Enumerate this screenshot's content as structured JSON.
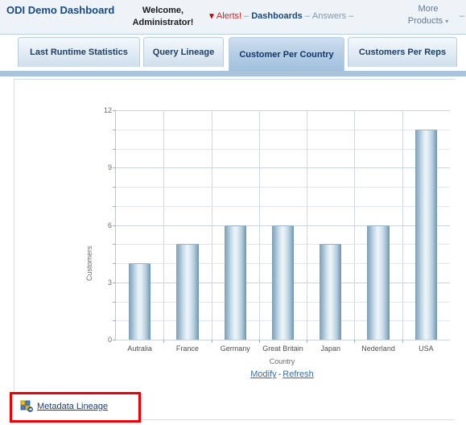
{
  "header": {
    "brand_title": "ODI Demo Dashboard",
    "welcome": "Welcome, Administrator!",
    "alerts_icon": "alert-flag-icon",
    "alerts_label": "Alerts!",
    "separator": "–",
    "dashboards_label": "Dashboards",
    "answers_label": "Answers",
    "more_products_label": "More Products",
    "more_products_caret": "▾",
    "trailing_separator": "–"
  },
  "tabs": [
    {
      "label": "Last Runtime Statistics",
      "active": false
    },
    {
      "label": "Query Lineage",
      "active": false
    },
    {
      "label": "Customer Per Country",
      "active": true
    },
    {
      "label": "Customers Per Reps",
      "active": false
    }
  ],
  "chart_links": {
    "modify_label": "Modify",
    "dash": "-",
    "refresh_label": "Refresh"
  },
  "footer": {
    "lineage_icon": "metadata-lineage-icon",
    "lineage_label": "Metadata Lineage",
    "annotation_color": "#ee0000"
  },
  "colors": {
    "brand_blue": "#19497e",
    "alert_red": "#e02020",
    "tab_active": "#9fc0dd",
    "bar_edge": "#7d9fb8",
    "bar_center": "#eef5fa",
    "link_blue": "#3b6ea5"
  },
  "chart_data": {
    "type": "bar",
    "title": "",
    "categories": [
      "Autralia",
      "France",
      "Germany",
      "Great Britain",
      "Japan",
      "Nederland",
      "USA"
    ],
    "values": [
      4,
      5,
      6,
      6,
      5,
      6,
      11
    ],
    "xlabel": "Country",
    "ylabel": "Customers",
    "ylim": [
      0,
      12
    ],
    "yticks": [
      0,
      3,
      6,
      9,
      12
    ],
    "yticklabels": [
      "0",
      "3",
      "6",
      "9",
      "12"
    ],
    "minor_gridline_step": 1,
    "grid": true,
    "legend": false
  }
}
